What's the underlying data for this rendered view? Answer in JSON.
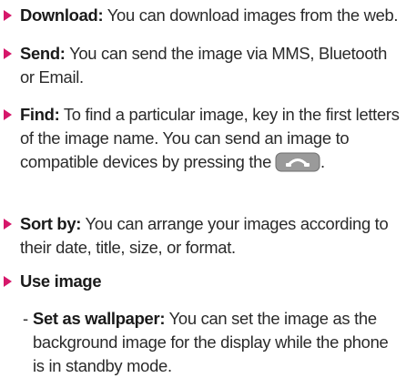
{
  "items": [
    {
      "term": "Download:",
      "desc": " You can download images from the web."
    },
    {
      "term": "Send:",
      "desc": " You can send the image via MMS, Bluetooth or Email."
    },
    {
      "term": "Find:",
      "desc": " To find a particular image, key in the first letters of the image name. You can send an image to compatible devices by pressing the",
      "desc_end": "."
    },
    {
      "term": "Sort by:",
      "desc": " You can arrange your images according to their date, title, size, or format."
    },
    {
      "term": "Use image",
      "desc": ""
    }
  ],
  "subitems": [
    {
      "dash": "-",
      "term": "Set as wallpaper:",
      "desc": " You can set the image as the background image for the display while the phone is in standby mode."
    }
  ],
  "icons": {
    "bullet": "triangle-right-icon",
    "send_key": "send-key-icon"
  },
  "colors": {
    "bullet": "#d6176a",
    "text": "#2a2a2a",
    "key_fill": "#9a9a9a"
  }
}
